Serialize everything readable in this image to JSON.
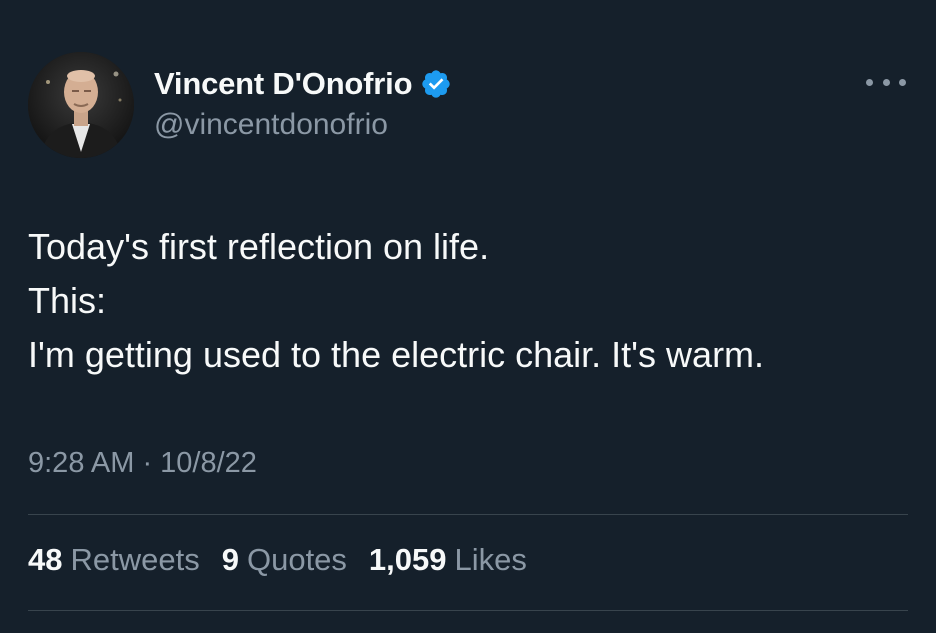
{
  "author": {
    "display_name": "Vincent D'Onofrio",
    "handle": "@vincentdonofrio",
    "verified": true,
    "avatar": "profile-photo"
  },
  "more_menu": {
    "icon": "more-horizontal-icon"
  },
  "tweet": {
    "lines": [
      "Today's first reflection on life.",
      "This:",
      "I'm getting used to the electric chair. It's warm."
    ],
    "timestamp": "9:28 AM · 10/8/22"
  },
  "stats": {
    "retweets": {
      "count": "48",
      "label": "Retweets"
    },
    "quotes": {
      "count": "9",
      "label": "Quotes"
    },
    "likes": {
      "count": "1,059",
      "label": "Likes"
    }
  },
  "colors": {
    "background": "#15202b",
    "primary_text": "#f7f9f9",
    "secondary_text": "#8b98a5",
    "verified_badge": "#1d9bf0",
    "divider": "#38444d"
  }
}
